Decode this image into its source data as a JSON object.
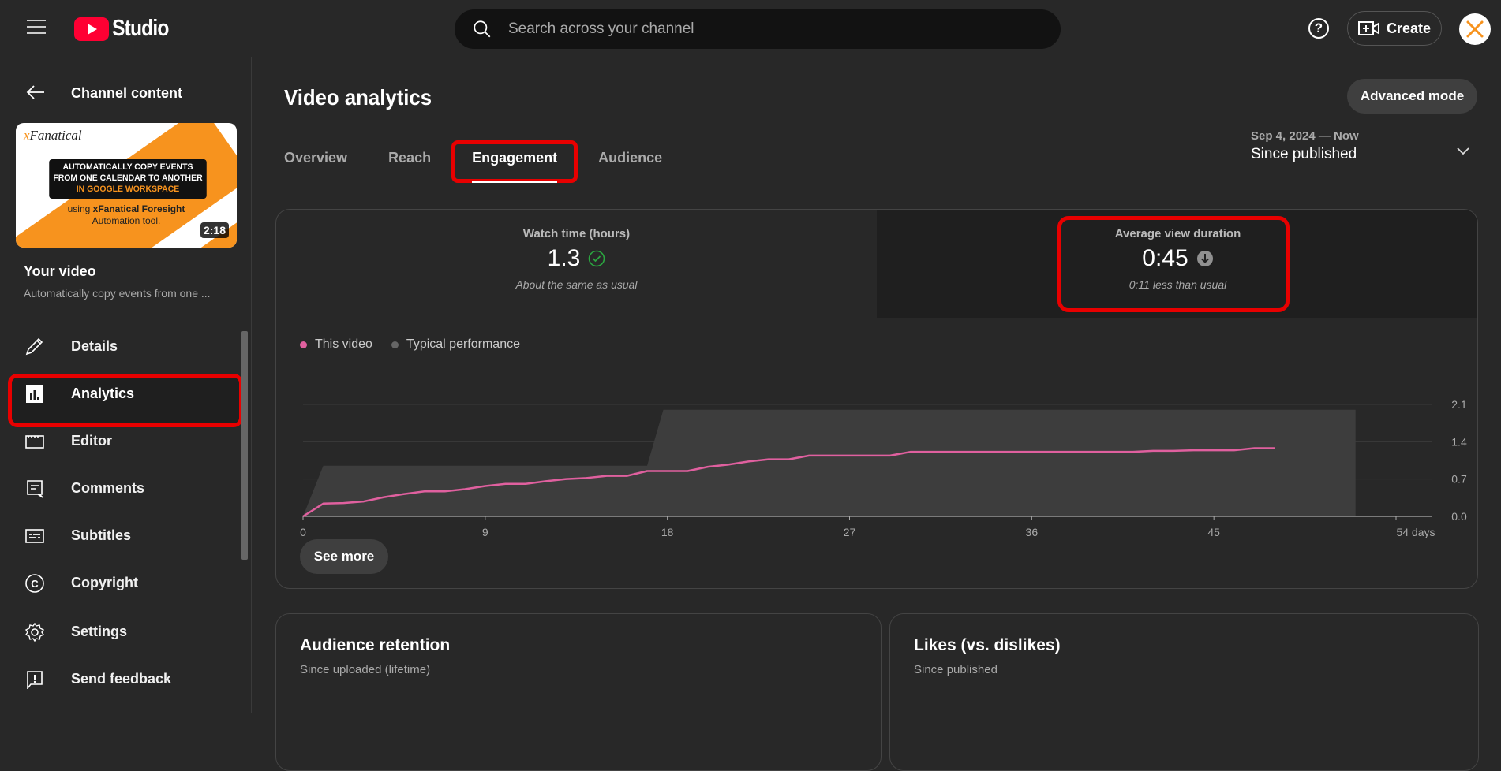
{
  "app": {
    "logo_text": "Studio"
  },
  "search": {
    "placeholder": "Search across your channel"
  },
  "header": {
    "help_label": "?",
    "create_label": "Create"
  },
  "sidebar": {
    "back_label": "Channel content",
    "thumbnail": {
      "brand": "Fanatical",
      "brand_prefix": "x",
      "banner_line1": "AUTOMATICALLY COPY EVENTS",
      "banner_line2": "FROM ONE CALENDAR TO ANOTHER",
      "banner_line3": "IN GOOGLE WORKSPACE",
      "using_line1_prefix": "using ",
      "using_line1_bold": "xFanatical Foresight",
      "using_line2": "Automation tool.",
      "duration": "2:18"
    },
    "your_video_label": "Your video",
    "video_title": "Automatically copy events from one ...",
    "items": [
      {
        "label": "Details",
        "icon": "pencil-icon"
      },
      {
        "label": "Analytics",
        "icon": "analytics-icon",
        "active": true
      },
      {
        "label": "Editor",
        "icon": "clapperboard-icon"
      },
      {
        "label": "Comments",
        "icon": "comment-icon"
      },
      {
        "label": "Subtitles",
        "icon": "subtitles-icon"
      },
      {
        "label": "Copyright",
        "icon": "copyright-icon"
      }
    ],
    "bottom_items": [
      {
        "label": "Settings",
        "icon": "gear-icon"
      },
      {
        "label": "Send feedback",
        "icon": "feedback-icon"
      }
    ]
  },
  "main": {
    "title": "Video analytics",
    "advanced_mode_label": "Advanced mode",
    "tabs": [
      {
        "label": "Overview"
      },
      {
        "label": "Reach"
      },
      {
        "label": "Engagement",
        "active": true
      },
      {
        "label": "Audience"
      }
    ],
    "date_range": {
      "range": "Sep 4, 2024 — Now",
      "label": "Since published"
    },
    "metrics": [
      {
        "label": "Watch time (hours)",
        "value": "1.3",
        "status": "check",
        "note": "About the same as usual"
      },
      {
        "label": "Average view duration",
        "value": "0:45",
        "status": "down",
        "note": "0:11 less than usual"
      }
    ],
    "see_more_label": "See more",
    "cards": [
      {
        "title": "Audience retention",
        "subtitle": "Since uploaded (lifetime)"
      },
      {
        "title": "Likes (vs. dislikes)",
        "subtitle": "Since published"
      }
    ]
  },
  "colors": {
    "accent_pink": "#e0609f",
    "typical_gray": "#3d3d3d",
    "highlight_red": "#e80000",
    "check_green": "#2ba640"
  },
  "chart_data": {
    "type": "line",
    "title": "Watch time (hours)",
    "xlabel": "days",
    "ylabel": "",
    "x_ticks": [
      "0",
      "9",
      "18",
      "27",
      "36",
      "45",
      "54 days"
    ],
    "y_ticks": [
      "0.0",
      "0.7",
      "1.4",
      "2.1"
    ],
    "xlim": [
      0,
      54
    ],
    "ylim": [
      0,
      2.1
    ],
    "grid": true,
    "legend": "top-left",
    "series": [
      {
        "name": "This video",
        "kind": "line",
        "x": [
          0,
          1,
          2,
          3,
          4,
          5,
          6,
          7,
          8,
          9,
          10,
          11,
          12,
          13,
          14,
          15,
          16,
          17,
          18,
          19,
          20,
          21,
          22,
          23,
          24,
          25,
          26,
          27,
          28,
          29,
          30,
          31,
          32,
          33,
          34,
          35,
          36,
          37,
          38,
          39,
          40,
          41,
          42,
          43,
          44,
          45,
          46,
          47,
          48
        ],
        "y": [
          0,
          0.24,
          0.25,
          0.28,
          0.36,
          0.42,
          0.47,
          0.47,
          0.51,
          0.57,
          0.61,
          0.61,
          0.66,
          0.7,
          0.72,
          0.76,
          0.76,
          0.85,
          0.85,
          0.85,
          0.93,
          0.97,
          1.03,
          1.07,
          1.07,
          1.14,
          1.14,
          1.14,
          1.14,
          1.14,
          1.21,
          1.21,
          1.21,
          1.21,
          1.21,
          1.21,
          1.21,
          1.21,
          1.21,
          1.21,
          1.21,
          1.21,
          1.23,
          1.23,
          1.24,
          1.24,
          1.24,
          1.28,
          1.28
        ]
      },
      {
        "name": "Typical performance",
        "kind": "area",
        "x": [
          0,
          1,
          16,
          17,
          17.8,
          52
        ],
        "y": [
          0,
          0.95,
          0.95,
          0.95,
          2.0,
          2.0
        ]
      }
    ]
  }
}
